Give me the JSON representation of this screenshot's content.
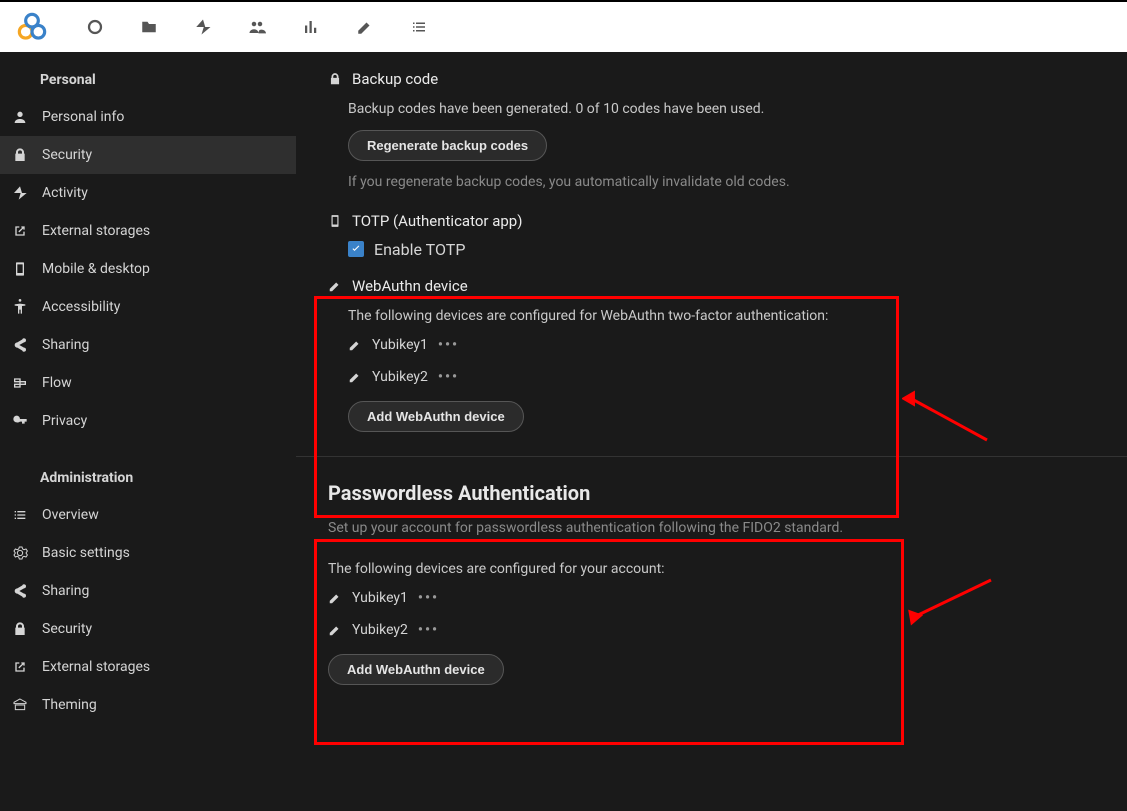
{
  "sidebar": {
    "personal_header": "Personal",
    "admin_header": "Administration",
    "personal_items": [
      {
        "label": "Personal info"
      },
      {
        "label": "Security"
      },
      {
        "label": "Activity"
      },
      {
        "label": "External storages"
      },
      {
        "label": "Mobile & desktop"
      },
      {
        "label": "Accessibility"
      },
      {
        "label": "Sharing"
      },
      {
        "label": "Flow"
      },
      {
        "label": "Privacy"
      }
    ],
    "admin_items": [
      {
        "label": "Overview"
      },
      {
        "label": "Basic settings"
      },
      {
        "label": "Sharing"
      },
      {
        "label": "Security"
      },
      {
        "label": "External storages"
      },
      {
        "label": "Theming"
      }
    ]
  },
  "backup": {
    "title": "Backup code",
    "status": "Backup codes have been generated. 0 of 10 codes have been used.",
    "regen_btn": "Regenerate backup codes",
    "warn": "If you regenerate backup codes, you automatically invalidate old codes."
  },
  "totp": {
    "title": "TOTP (Authenticator app)",
    "enable_label": "Enable TOTP"
  },
  "webauthn": {
    "title": "WebAuthn device",
    "desc": "The following devices are configured for WebAuthn two-factor authentication:",
    "dev1": "Yubikey1",
    "dev2": "Yubikey2",
    "add_btn": "Add WebAuthn device"
  },
  "passwordless": {
    "title": "Passwordless Authentication",
    "desc": "Set up your account for passwordless authentication following the FIDO2 standard.",
    "conf": "The following devices are configured for your account:",
    "dev1": "Yubikey1",
    "dev2": "Yubikey2",
    "add_btn": "Add WebAuthn device"
  }
}
